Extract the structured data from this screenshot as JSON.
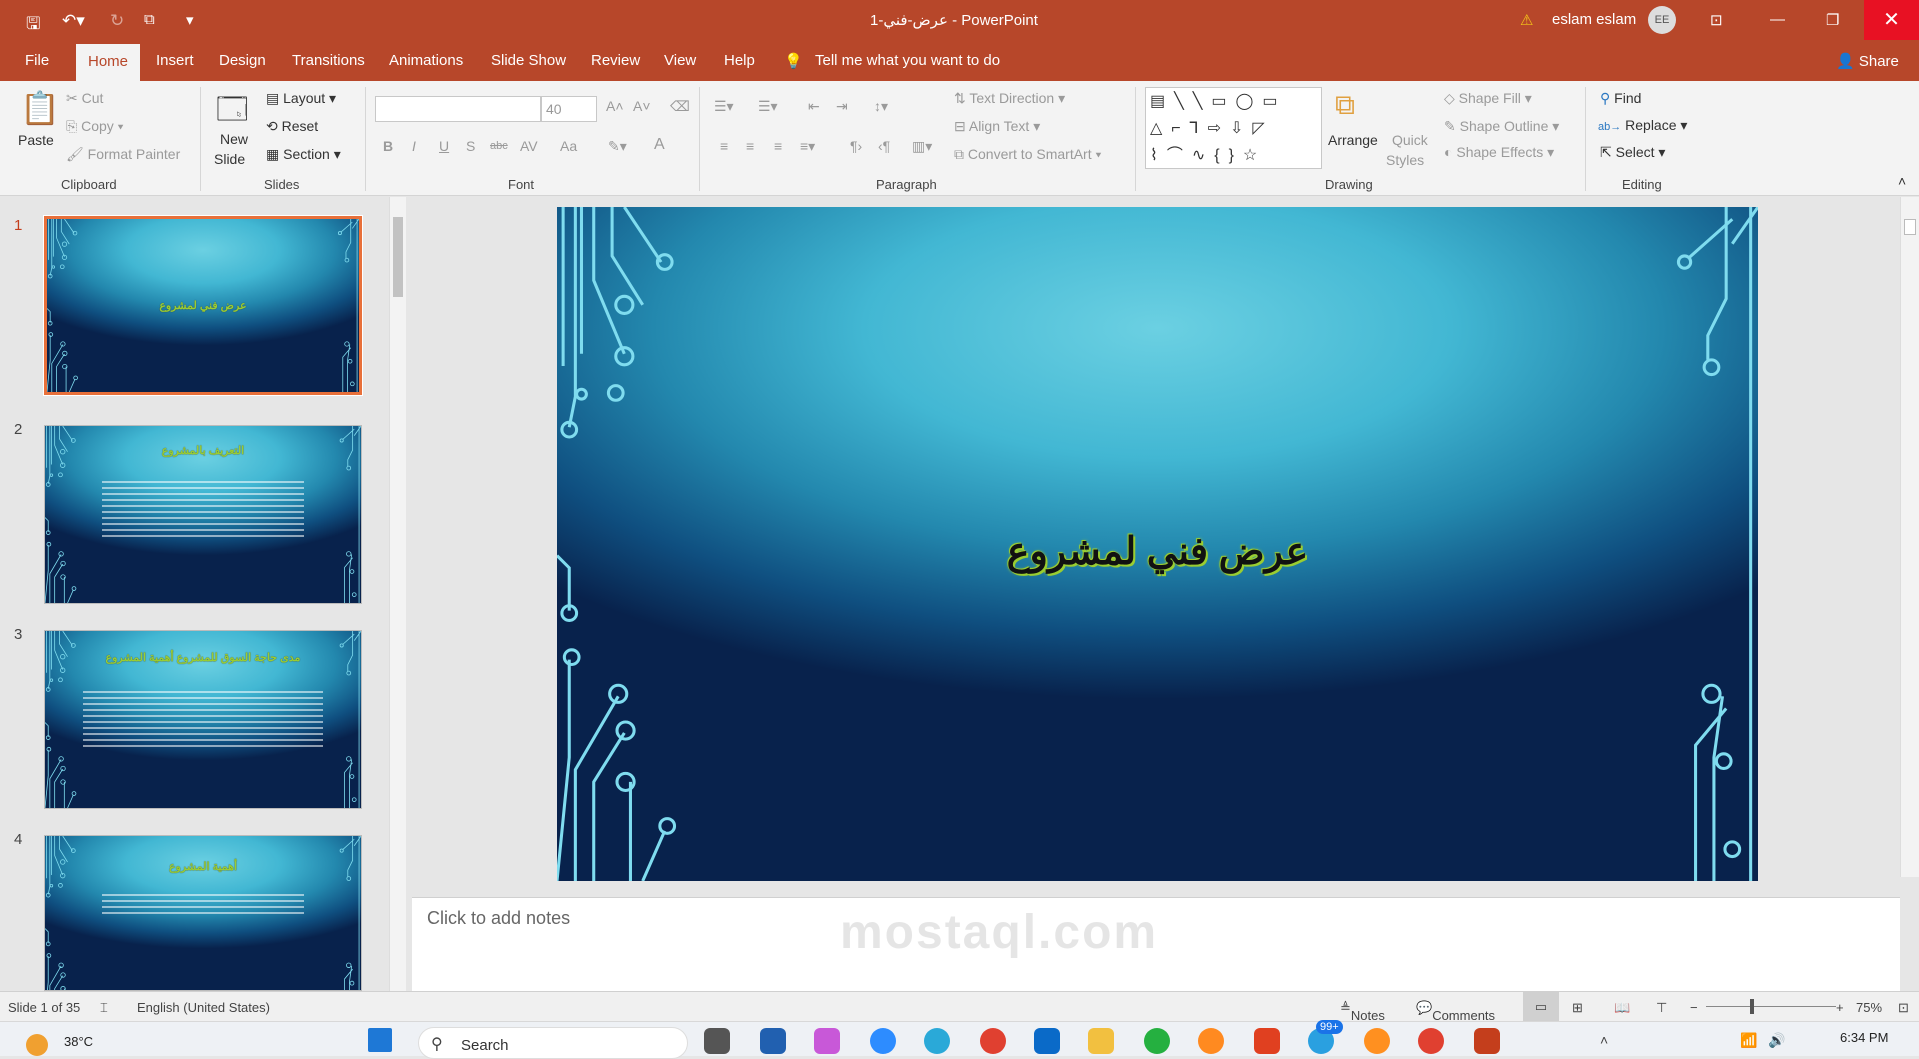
{
  "titlebar": {
    "title": "عرض-فني-1  -  PowerPoint",
    "warning_icon": "warning-icon",
    "user": "eslam eslam",
    "avatar_initials": "EE",
    "qat": [
      "save-icon",
      "undo-icon",
      "redo-icon",
      "start-from-beginning-icon",
      "customize-qat-icon"
    ]
  },
  "tabs": [
    "File",
    "Home",
    "Insert",
    "Design",
    "Transitions",
    "Animations",
    "Slide Show",
    "Review",
    "View",
    "Help"
  ],
  "active_tab": "Home",
  "tell_me": "Tell me what you want to do",
  "share": "Share",
  "ribbon": {
    "clipboard": {
      "label": "Clipboard",
      "paste": "Paste",
      "cut": "Cut",
      "copy": "Copy",
      "format_painter": "Format Painter"
    },
    "slides": {
      "label": "Slides",
      "new_slide": "New",
      "new_slide2": "Slide",
      "layout": "Layout",
      "reset": "Reset",
      "section": "Section"
    },
    "font": {
      "label": "Font",
      "font_name": "",
      "font_size": "40",
      "buttons": [
        "B",
        "I",
        "U",
        "S",
        "abc",
        "AV",
        "Aa",
        "A"
      ]
    },
    "paragraph": {
      "label": "Paragraph",
      "text_direction": "Text Direction",
      "align_text": "Align Text",
      "convert_smartart": "Convert to SmartArt"
    },
    "drawing": {
      "label": "Drawing",
      "arrange": "Arrange",
      "quick_styles": "Quick",
      "quick_styles2": "Styles",
      "shape_fill": "Shape Fill",
      "shape_outline": "Shape Outline",
      "shape_effects": "Shape Effects"
    },
    "editing": {
      "label": "Editing",
      "find": "Find",
      "replace": "Replace",
      "select": "Select"
    }
  },
  "thumbnails": [
    {
      "num": "1",
      "title": "عرض فني  لمشروع",
      "selected": true
    },
    {
      "num": "2",
      "title": "التعريف بالمشروع"
    },
    {
      "num": "3",
      "title": "مدى حاجة السوق للمشروع أهمية المشروع"
    },
    {
      "num": "4",
      "title": "أهمية المشروع"
    }
  ],
  "slide": {
    "title": "عرض فني   لمشروع",
    "accent": "#9acd32"
  },
  "notes_placeholder": "Click to add notes",
  "status": {
    "slide_of": "Slide 1 of 35",
    "language": "English (United States)",
    "notes": "Notes",
    "comments": "Comments",
    "zoom": "75%",
    "zoom_percent": 75
  },
  "taskbar": {
    "weather": "38°C",
    "search": "Search",
    "badge": "99+",
    "time": "6:34 PM"
  },
  "watermark": "mostaql.com"
}
